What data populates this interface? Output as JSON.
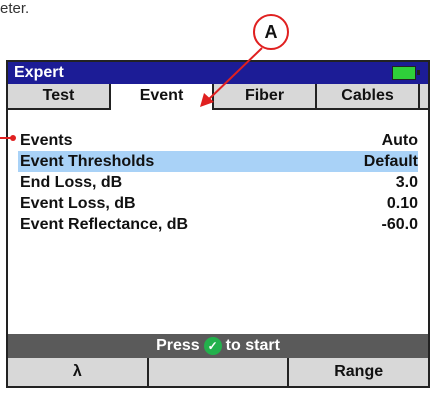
{
  "caption": "eter.",
  "callout": {
    "label": "A"
  },
  "window": {
    "title": "Expert"
  },
  "tabs": [
    {
      "label": "Test"
    },
    {
      "label": "Event"
    },
    {
      "label": "Fiber"
    },
    {
      "label": "Cables"
    }
  ],
  "rows": [
    {
      "label": "Events",
      "value": "Auto"
    },
    {
      "label": "Event Thresholds",
      "value": "Default",
      "selected": true
    },
    {
      "label": "End Loss, dB",
      "value": "3.0"
    },
    {
      "label": "Event Loss, dB",
      "value": "0.10"
    },
    {
      "label": "Event Reflectance, dB",
      "value": "-60.0"
    }
  ],
  "status": {
    "pre": "Press",
    "post": "to start"
  },
  "softkeys": [
    {
      "label": "λ"
    },
    {
      "label": ""
    },
    {
      "label": "Range"
    }
  ],
  "colors": {
    "title_bg": "#1c1c96",
    "selection": "#a9d2f7",
    "callout": "#e02020",
    "battery": "#2fcf3a"
  }
}
